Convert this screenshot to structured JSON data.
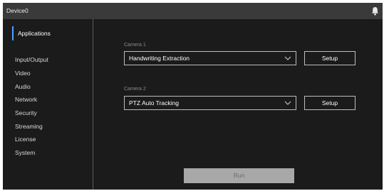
{
  "window": {
    "title": "Device0"
  },
  "icons": {
    "notifications": "bell-icon",
    "dropdown": "chevron-down-icon"
  },
  "colors": {
    "accent": "#4ea3ff",
    "background": "#1b1b1b",
    "titlebar": "#3a3a3a"
  },
  "sidebar": {
    "items": [
      {
        "label": "Applications",
        "active": true
      },
      {
        "label": "Input/Output"
      },
      {
        "label": "Video"
      },
      {
        "label": "Audio"
      },
      {
        "label": "Network"
      },
      {
        "label": "Security"
      },
      {
        "label": "Streaming"
      },
      {
        "label": "License"
      },
      {
        "label": "System"
      }
    ]
  },
  "main": {
    "camera1": {
      "label": "Camera 1",
      "selected": "Handwriting Extraction",
      "setup_label": "Setup"
    },
    "camera2": {
      "label": "Camera 2",
      "selected": "PTZ Auto Tracking",
      "setup_label": "Setup"
    },
    "run_label": "Run"
  }
}
